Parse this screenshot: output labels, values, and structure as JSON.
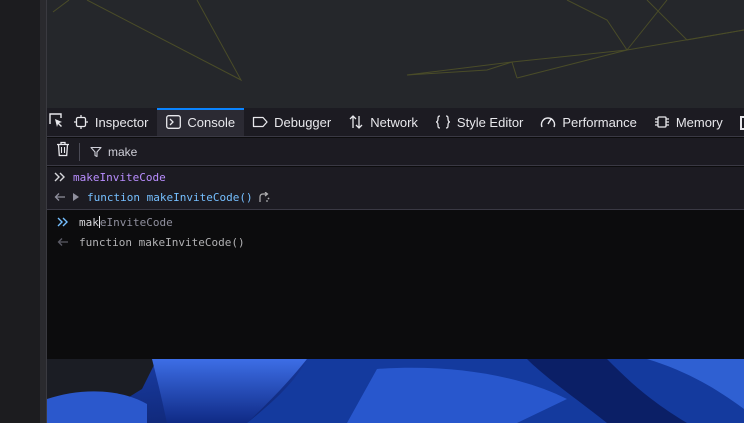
{
  "colors": {
    "accent": "#0a84ff",
    "input_prompt": "#75bfff",
    "echo_text": "#b98eff",
    "result_text": "#75bfff",
    "toolbar_bg": "#1c1b22",
    "console_bg": "#0c0c0d"
  },
  "toolbar": {
    "picker_icon": "element-picker-icon",
    "tabs": [
      {
        "label": "Inspector",
        "icon": "inspector-icon",
        "selected": false
      },
      {
        "label": "Console",
        "icon": "console-icon",
        "selected": true
      },
      {
        "label": "Debugger",
        "icon": "debugger-icon",
        "selected": false
      },
      {
        "label": "Network",
        "icon": "network-icon",
        "selected": false
      },
      {
        "label": "Style Editor",
        "icon": "style-editor-icon",
        "selected": false
      },
      {
        "label": "Performance",
        "icon": "performance-icon",
        "selected": false
      },
      {
        "label": "Memory",
        "icon": "memory-icon",
        "selected": false
      }
    ]
  },
  "filterbar": {
    "clear_icon": "trash-icon",
    "filter_icon": "filter-icon",
    "filter_value": "make"
  },
  "console": {
    "history": [
      {
        "type": "input",
        "text": "makeInviteCode"
      },
      {
        "type": "result",
        "text": "function makeInviteCode()"
      }
    ],
    "input": {
      "typed": "mak",
      "autocomplete": "eInviteCode"
    },
    "eager_preview": "function makeInviteCode()"
  }
}
